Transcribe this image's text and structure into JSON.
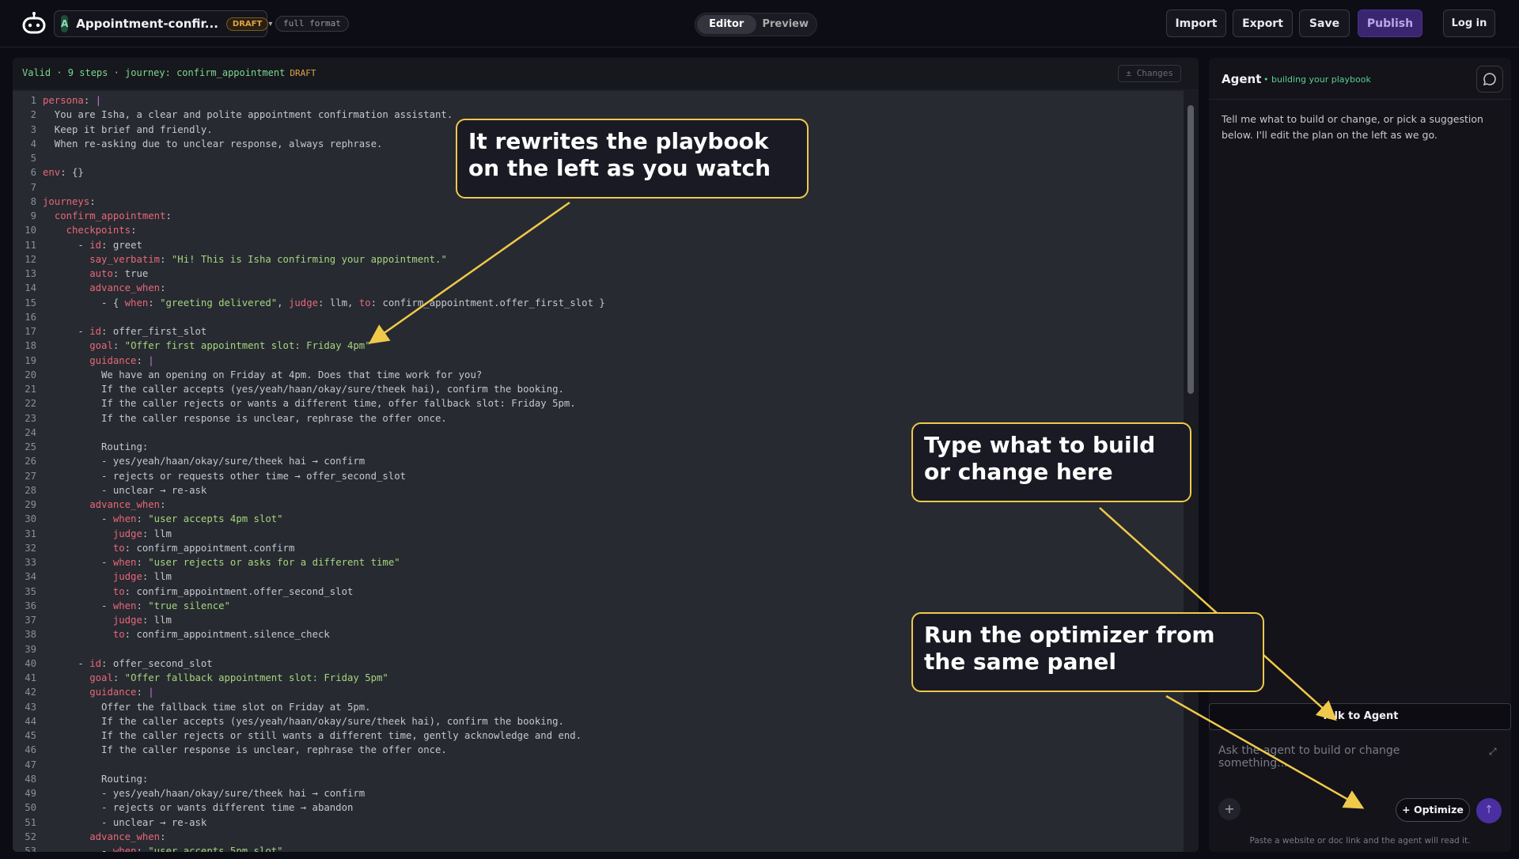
{
  "topbar": {
    "avatar": "A",
    "project_name": "Appointment-confir...",
    "draft_badge": "DRAFT",
    "format_chip": "full format",
    "tabs": [
      "Editor",
      "Preview"
    ],
    "buttons": {
      "import": "Import",
      "export": "Export",
      "save": "Save",
      "publish": "Publish",
      "login": "Log in"
    }
  },
  "editor": {
    "status": "Valid · 9 steps · journey: confirm_appointment",
    "status_badge": "DRAFT",
    "changes_button": "± Changes",
    "lines": [
      [
        {
          "c": "k",
          "t": "persona"
        },
        {
          "t": ": "
        },
        {
          "c": "sy",
          "t": "|"
        }
      ],
      [
        {
          "t": "  You are Isha, a clear and polite appointment confirmation assistant."
        }
      ],
      [
        {
          "t": "  Keep it brief and friendly."
        }
      ],
      [
        {
          "t": "  When re-asking due to unclear response, always rephrase."
        }
      ],
      [],
      [
        {
          "c": "k",
          "t": "env"
        },
        {
          "t": ": {}"
        }
      ],
      [],
      [
        {
          "c": "k",
          "t": "journeys"
        },
        {
          "t": ":"
        }
      ],
      [
        {
          "t": "  "
        },
        {
          "c": "k",
          "t": "confirm_appointment"
        },
        {
          "t": ":"
        }
      ],
      [
        {
          "t": "    "
        },
        {
          "c": "k",
          "t": "checkpoints"
        },
        {
          "t": ":"
        }
      ],
      [
        {
          "t": "      - "
        },
        {
          "c": "k",
          "t": "id"
        },
        {
          "t": ": greet"
        }
      ],
      [
        {
          "t": "        "
        },
        {
          "c": "k",
          "t": "say_verbatim"
        },
        {
          "t": ": "
        },
        {
          "c": "s",
          "t": "\"Hi! This is Isha confirming your appointment.\""
        }
      ],
      [
        {
          "t": "        "
        },
        {
          "c": "k",
          "t": "auto"
        },
        {
          "t": ": true"
        }
      ],
      [
        {
          "t": "        "
        },
        {
          "c": "k",
          "t": "advance_when"
        },
        {
          "t": ":"
        }
      ],
      [
        {
          "t": "          - { "
        },
        {
          "c": "k",
          "t": "when"
        },
        {
          "t": ": "
        },
        {
          "c": "s",
          "t": "\"greeting delivered\""
        },
        {
          "t": ", "
        },
        {
          "c": "k",
          "t": "judge"
        },
        {
          "t": ": llm, "
        },
        {
          "c": "k",
          "t": "to"
        },
        {
          "t": ": confirm_appointment.offer_first_slot }"
        }
      ],
      [],
      [
        {
          "t": "      - "
        },
        {
          "c": "k",
          "t": "id"
        },
        {
          "t": ": offer_first_slot"
        }
      ],
      [
        {
          "t": "        "
        },
        {
          "c": "k",
          "t": "goal"
        },
        {
          "t": ": "
        },
        {
          "c": "s",
          "t": "\"Offer first appointment slot: Friday 4pm\""
        }
      ],
      [
        {
          "t": "        "
        },
        {
          "c": "k",
          "t": "guidance"
        },
        {
          "t": ": "
        },
        {
          "c": "sy",
          "t": "|"
        }
      ],
      [
        {
          "t": "          We have an opening on Friday at 4pm. Does that time work for you?"
        }
      ],
      [
        {
          "t": "          If the caller accepts (yes/yeah/haan/okay/sure/theek hai), confirm the booking."
        }
      ],
      [
        {
          "t": "          If the caller rejects or wants a different time, offer fallback slot: Friday 5pm."
        }
      ],
      [
        {
          "t": "          If the caller response is unclear, rephrase the offer once."
        }
      ],
      [],
      [
        {
          "t": "          Routing:"
        }
      ],
      [
        {
          "t": "          - yes/yeah/haan/okay/sure/theek hai → confirm"
        }
      ],
      [
        {
          "t": "          - rejects or requests other time → offer_second_slot"
        }
      ],
      [
        {
          "t": "          - unclear → re-ask"
        }
      ],
      [
        {
          "t": "        "
        },
        {
          "c": "k",
          "t": "advance_when"
        },
        {
          "t": ":"
        }
      ],
      [
        {
          "t": "          - "
        },
        {
          "c": "k",
          "t": "when"
        },
        {
          "t": ": "
        },
        {
          "c": "s",
          "t": "\"user accepts 4pm slot\""
        }
      ],
      [
        {
          "t": "            "
        },
        {
          "c": "k",
          "t": "judge"
        },
        {
          "t": ": llm"
        }
      ],
      [
        {
          "t": "            "
        },
        {
          "c": "k",
          "t": "to"
        },
        {
          "t": ": confirm_appointment.confirm"
        }
      ],
      [
        {
          "t": "          - "
        },
        {
          "c": "k",
          "t": "when"
        },
        {
          "t": ": "
        },
        {
          "c": "s",
          "t": "\"user rejects or asks for a different time\""
        }
      ],
      [
        {
          "t": "            "
        },
        {
          "c": "k",
          "t": "judge"
        },
        {
          "t": ": llm"
        }
      ],
      [
        {
          "t": "            "
        },
        {
          "c": "k",
          "t": "to"
        },
        {
          "t": ": confirm_appointment.offer_second_slot"
        }
      ],
      [
        {
          "t": "          - "
        },
        {
          "c": "k",
          "t": "when"
        },
        {
          "t": ": "
        },
        {
          "c": "s",
          "t": "\"true silence\""
        }
      ],
      [
        {
          "t": "            "
        },
        {
          "c": "k",
          "t": "judge"
        },
        {
          "t": ": llm"
        }
      ],
      [
        {
          "t": "            "
        },
        {
          "c": "k",
          "t": "to"
        },
        {
          "t": ": confirm_appointment.silence_check"
        }
      ],
      [],
      [
        {
          "t": "      - "
        },
        {
          "c": "k",
          "t": "id"
        },
        {
          "t": ": offer_second_slot"
        }
      ],
      [
        {
          "t": "        "
        },
        {
          "c": "k",
          "t": "goal"
        },
        {
          "t": ": "
        },
        {
          "c": "s",
          "t": "\"Offer fallback appointment slot: Friday 5pm\""
        }
      ],
      [
        {
          "t": "        "
        },
        {
          "c": "k",
          "t": "guidance"
        },
        {
          "t": ": "
        },
        {
          "c": "sy",
          "t": "|"
        }
      ],
      [
        {
          "t": "          Offer the fallback time slot on Friday at 5pm."
        }
      ],
      [
        {
          "t": "          If the caller accepts (yes/yeah/haan/okay/sure/theek hai), confirm the booking."
        }
      ],
      [
        {
          "t": "          If the caller rejects or still wants a different time, gently acknowledge and end."
        }
      ],
      [
        {
          "t": "          If the caller response is unclear, rephrase the offer once."
        }
      ],
      [],
      [
        {
          "t": "          Routing:"
        }
      ],
      [
        {
          "t": "          - yes/yeah/haan/okay/sure/theek hai → confirm"
        }
      ],
      [
        {
          "t": "          - rejects or wants different time → abandon"
        }
      ],
      [
        {
          "t": "          - unclear → re-ask"
        }
      ],
      [
        {
          "t": "        "
        },
        {
          "c": "k",
          "t": "advance_when"
        },
        {
          "t": ":"
        }
      ],
      [
        {
          "t": "          - "
        },
        {
          "c": "k",
          "t": "when"
        },
        {
          "t": ": "
        },
        {
          "c": "s",
          "t": "\"user accepts 5pm slot\""
        }
      ]
    ]
  },
  "agent": {
    "title": "Agent",
    "status": "• building your playbook",
    "message": "Tell me what to build or change, or pick a suggestion below. I'll edit the plan on the left as we go.",
    "talk_button": "Talk to Agent",
    "input_placeholder": "Ask the agent to build or change something...",
    "optimize_button": "+ Optimize",
    "hint": "Paste a website or doc link and the agent will read it."
  },
  "callouts": {
    "rewrite": "It rewrites the playbook on the left as you watch",
    "type": "Type what to build or change here",
    "optimize": "Run the optimizer from the same panel"
  },
  "colors": {
    "accent": "#f0c94a",
    "publish": "#3a2670",
    "keyword": "#e8677a",
    "string": "#a6d57f",
    "ok": "#7bd88f"
  }
}
